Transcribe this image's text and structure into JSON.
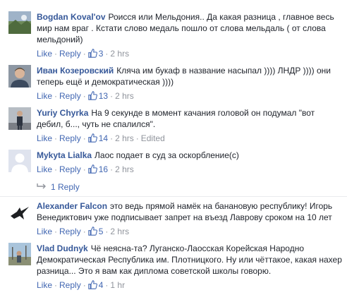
{
  "labels": {
    "like": "Like",
    "reply": "Reply",
    "dot": "·"
  },
  "comments": [
    {
      "author": "Bogdan Koval'ov",
      "text": "Роисся или Мельдония.. Да какая разница , главное весь мир нам враг . Кстати слово медаль пошло от слова мельдаль ( от слова мельдоний)",
      "likes": "3",
      "time": "2 hrs",
      "avatar_icon": "landscape-photo-avatar"
    },
    {
      "author": "Иван Козеровский",
      "text": "Кляча им букаф в название насыпал )))) ЛНДР )))) они теперь ещё и демократическая ))))",
      "likes": "13",
      "time": "2 hrs",
      "avatar_icon": "man-portrait-avatar"
    },
    {
      "author": "Yuriy Chyrka",
      "text": "На 9 секунде в момент качания головой он подумал \"вот дебил, б..., чуть не спалился\".",
      "likes": "14",
      "time": "2 hrs",
      "edited": "Edited",
      "avatar_icon": "person-standing-avatar"
    },
    {
      "author": "Mykyta Lialka",
      "text": "Лаос подает в суд за оскорбление(с)",
      "likes": "16",
      "time": "2 hrs",
      "avatar_icon": "default-silhouette-avatar"
    },
    {
      "author": "Alexander Falcon",
      "text": "это ведь прямой намёк на банановую республику! Игорь Венедиктович уже подписывает запрет на въезд Лаврову сроком на 10 лет",
      "likes": "5",
      "time": "2 hrs",
      "avatar_icon": "falcon-bird-avatar"
    },
    {
      "author": "Vlad Dudnyk",
      "text": "Чё неясна-та? Луганско-Лаосская Корейская Народно Демократическая Республика им. Плотницкого. Ну или чёттакое, какая нахер разница... Это я вам как диплома советской школы говорю.",
      "likes": "4",
      "time": "1 hr",
      "avatar_icon": "outdoor-photo-avatar"
    }
  ],
  "replies_link": {
    "label": "1 Reply"
  },
  "colors": {
    "author": "#365899",
    "link": "#4267b2",
    "meta": "#90949c",
    "divider": "#e9ebee"
  }
}
